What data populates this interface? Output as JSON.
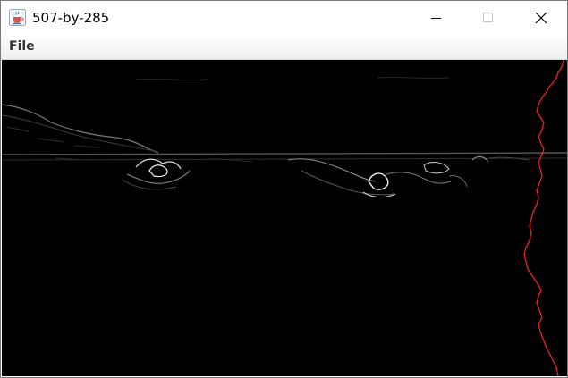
{
  "window": {
    "title": "507-by-285",
    "icon": "java-coffee-icon"
  },
  "titlebar_buttons": {
    "minimize": "minimize-icon",
    "maximize": "maximize-icon",
    "close": "close-icon"
  },
  "menubar": {
    "items": [
      {
        "label": "File"
      }
    ]
  },
  "image": {
    "description_icon": "edge-detection-image",
    "background_color": "#000000",
    "seam_color": "#ff2020"
  }
}
